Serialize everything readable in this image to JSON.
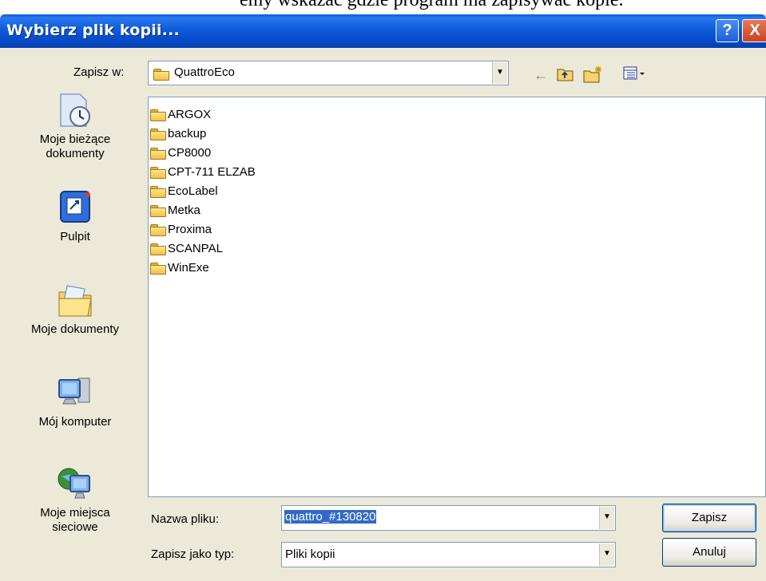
{
  "background_fragment": "emy wskazać gdzie program ma zapisywać kopie.",
  "window": {
    "title": "Wybierz plik kopii...",
    "help_button": "?",
    "close_button": "X"
  },
  "save_in": {
    "label": "Zapisz w:",
    "value": "QuattroEco"
  },
  "toolbar": {
    "back_icon": "back-arrow-icon",
    "up_icon": "up-folder-icon",
    "new_folder_icon": "new-folder-icon",
    "view_menu_icon": "view-menu-icon"
  },
  "places": [
    {
      "label": "Moje bieżące dokumenty",
      "icon": "recent-documents-icon"
    },
    {
      "label": "Pulpit",
      "icon": "desktop-icon"
    },
    {
      "label": "Moje dokumenty",
      "icon": "my-documents-icon"
    },
    {
      "label": "Mój komputer",
      "icon": "my-computer-icon"
    },
    {
      "label": "Moje miejsca sieciowe",
      "icon": "network-places-icon"
    }
  ],
  "folders": [
    "ARGOX",
    "backup",
    "CP8000",
    "CPT-711 ELZAB",
    "EcoLabel",
    "Metka",
    "Proxima",
    "SCANPAL",
    "WinExe"
  ],
  "filename": {
    "label": "Nazwa pliku:",
    "value": "quattro_#130820"
  },
  "filetype": {
    "label": "Zapisz jako typ:",
    "value": "Pliki kopii"
  },
  "buttons": {
    "save": "Zapisz",
    "cancel": "Anuluj"
  },
  "colors": {
    "titlebar": "#0a5ad8",
    "dialog_bg": "#ece9d8",
    "selection": "#316ac5"
  }
}
